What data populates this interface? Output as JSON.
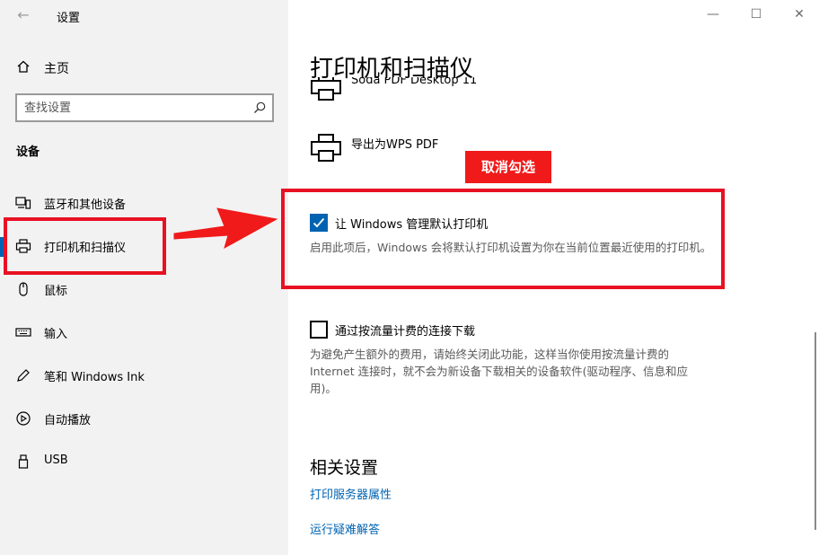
{
  "window": {
    "title": "设置"
  },
  "sidebar": {
    "home_label": "主页",
    "search": {
      "placeholder": "查找设置",
      "value": ""
    },
    "section_title": "设备",
    "items": [
      {
        "label": "蓝牙和其他设备",
        "icon": "bluetooth-devices-icon"
      },
      {
        "label": "打印机和扫描仪",
        "icon": "printer-icon",
        "active": true
      },
      {
        "label": "鼠标",
        "icon": "mouse-icon"
      },
      {
        "label": "输入",
        "icon": "keyboard-icon"
      },
      {
        "label": "笔和 Windows Ink",
        "icon": "pen-icon"
      },
      {
        "label": "自动播放",
        "icon": "autoplay-icon"
      },
      {
        "label": "USB",
        "icon": "usb-icon"
      }
    ]
  },
  "main": {
    "title": "打印机和扫描仪",
    "printers": [
      {
        "label": "Soda PDF Desktop 11"
      },
      {
        "label": "导出为WPS PDF"
      }
    ],
    "settings": [
      {
        "label": "让 Windows 管理默认打印机",
        "checked": true,
        "description": "启用此项后，Windows 会将默认打印机设置为你在当前位置最近使用的打印机。"
      },
      {
        "label": "通过按流量计费的连接下载",
        "checked": false,
        "description": "为避免产生额外的费用，请始终关闭此功能，这样当你使用按流量计费的 Internet 连接时，就不会为新设备下载相关的设备软件(驱动程序、信息和应用)。"
      }
    ],
    "related": {
      "title": "相关设置",
      "links": [
        "打印服务器属性",
        "运行疑难解答"
      ]
    }
  },
  "annotation": {
    "tag": "取消勾选"
  },
  "colors": {
    "accent": "#0063b1",
    "annotation": "#e81123",
    "sidebar_bg": "#f2f2f2"
  }
}
